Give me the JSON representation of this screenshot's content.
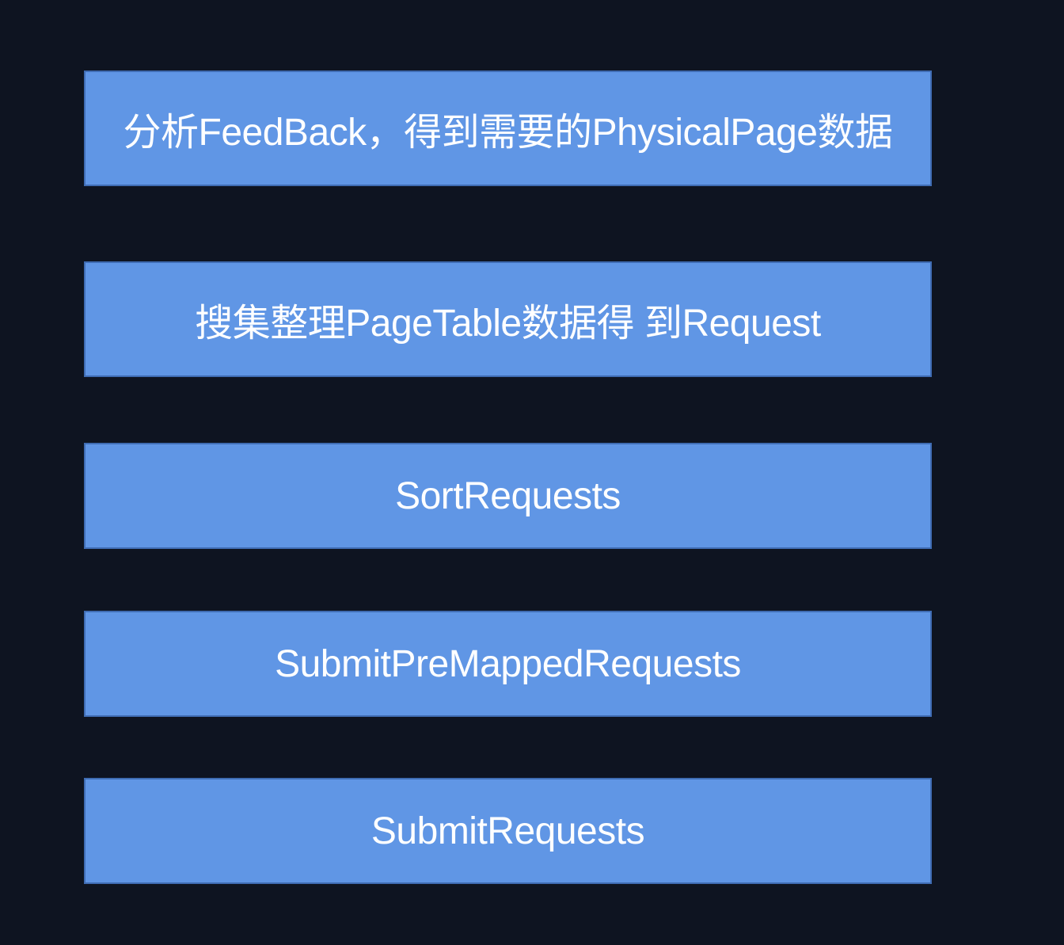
{
  "steps": [
    {
      "label": "分析FeedBack，得到需要的PhysicalPage数据"
    },
    {
      "label": "搜集整理PageTable数据得 到Request"
    },
    {
      "label": "SortRequests"
    },
    {
      "label": "SubmitPreMappedRequests"
    },
    {
      "label": "SubmitRequests"
    }
  ],
  "colors": {
    "background": "#0e1421",
    "box_fill": "#6096e5",
    "box_border": "#3f6cb3",
    "text": "#ffffff"
  }
}
